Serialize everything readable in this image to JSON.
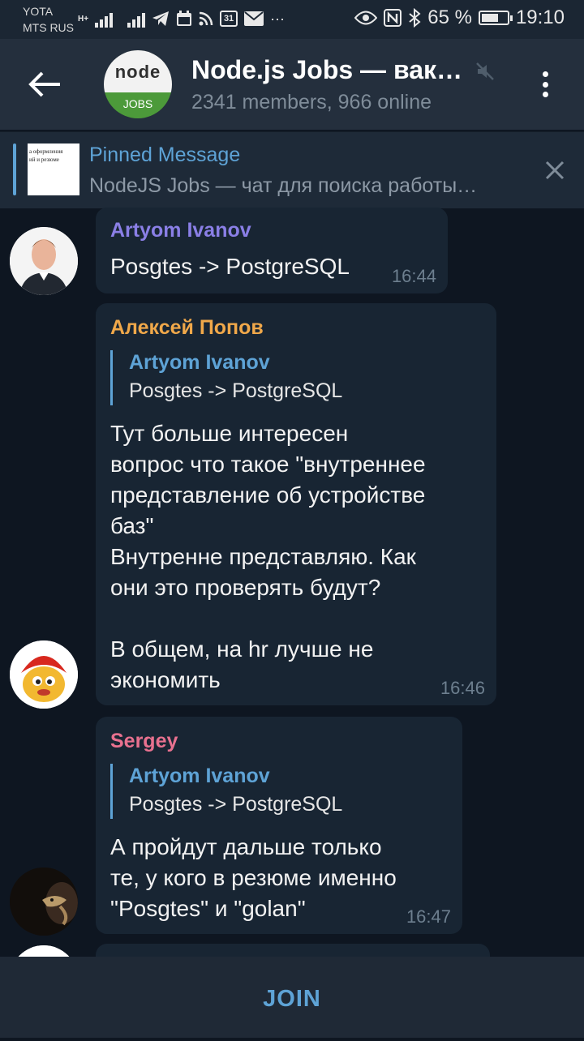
{
  "status_bar": {
    "carrier_top": "YOTA",
    "carrier_bottom": "MTS RUS",
    "net_type": "H+",
    "battery_percent": "65 %",
    "battery_level": 0.65,
    "time": "19:10",
    "calendar_day": "31",
    "icons": [
      "signal-icon",
      "telegram-icon",
      "calendar-icon",
      "rss-icon",
      "mail-icon",
      "more-notifications-icon",
      "eye-icon",
      "nfc-icon",
      "bluetooth-icon",
      "battery-icon"
    ]
  },
  "header": {
    "title": "Node.js Jobs — вак…",
    "subtitle": "2341 members, 966 online",
    "avatar_logo": "node",
    "avatar_badge": "JOBS"
  },
  "pinned": {
    "title": "Pinned Message",
    "text": "NodeJS Jobs — чат для поиска работы…",
    "thumb_line1": "а оформления",
    "thumb_line2": "ий и резюме"
  },
  "messages": [
    {
      "sender": "Artyom Ivanov",
      "sender_color": "#8a7fe6",
      "text": "Posgtes -> PostgreSQL",
      "time": "16:44"
    },
    {
      "sender": "Алексей Попов",
      "sender_color": "#f0a84a",
      "reply": {
        "name": "Artyom Ivanov",
        "text": "Posgtes -> PostgreSQL"
      },
      "text": "Тут больше интересен\nвопрос что такое \"внутреннее\nпредставление об устройстве\nбаз\"\nВнутренне представляю. Как\nони это проверять будут?\n\nВ общем, на hr лучше не\nэкономить",
      "time": "16:46"
    },
    {
      "sender": "Sergey",
      "sender_color": "#e8718f",
      "reply": {
        "name": "Artyom Ivanov",
        "text": "Posgtes -> PostgreSQL"
      },
      "text": "А пройдут дальше только\nте, у кого в резюме именно\n\"Posgtes\" и \"golan\"",
      "time": "16:47"
    }
  ],
  "join_label": "JOIN",
  "colors": {
    "background": "#0e1621",
    "header": "#242f3d",
    "bubble": "#182533",
    "accent": "#5ea3d6"
  }
}
